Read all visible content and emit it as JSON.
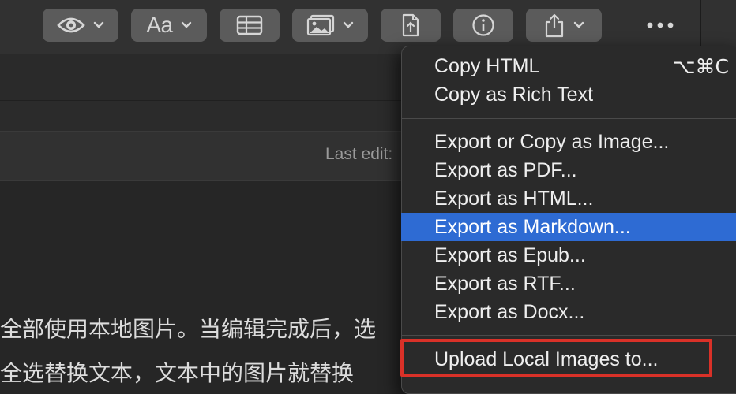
{
  "toolbar": {
    "buttons": [
      {
        "icon": "eye-icon",
        "has_chevron": true
      },
      {
        "label": "Aa",
        "has_chevron": true
      },
      {
        "icon": "table-icon",
        "has_chevron": false
      },
      {
        "icon": "image-icon",
        "has_chevron": true
      },
      {
        "icon": "export-file-icon",
        "has_chevron": false
      },
      {
        "icon": "info-icon",
        "has_chevron": false
      },
      {
        "icon": "share-icon",
        "has_chevron": true
      }
    ],
    "aa_label": "Aa"
  },
  "document": {
    "last_edit": "Last edit:",
    "line1": "全部使用本地图片。当编辑完成后，选",
    "line2": "全选替换文本，文本中的图片就替换"
  },
  "menu": {
    "group1": [
      {
        "label": "Copy HTML",
        "shortcut": "⌥⌘C"
      },
      {
        "label": "Copy as Rich Text"
      }
    ],
    "group2": [
      {
        "label": "Export or Copy as Image..."
      },
      {
        "label": "Export as PDF..."
      },
      {
        "label": "Export as HTML..."
      },
      {
        "label": "Export as Markdown...",
        "highlighted": true
      },
      {
        "label": "Export as Epub..."
      },
      {
        "label": "Export as RTF..."
      },
      {
        "label": "Export as Docx..."
      }
    ],
    "group3": [
      {
        "label": "Upload Local Images to...",
        "outlined": true
      }
    ]
  },
  "colors": {
    "highlight": "#2e6bd3",
    "outline": "#d93128",
    "toolbar_button": "#5b5b5b"
  }
}
